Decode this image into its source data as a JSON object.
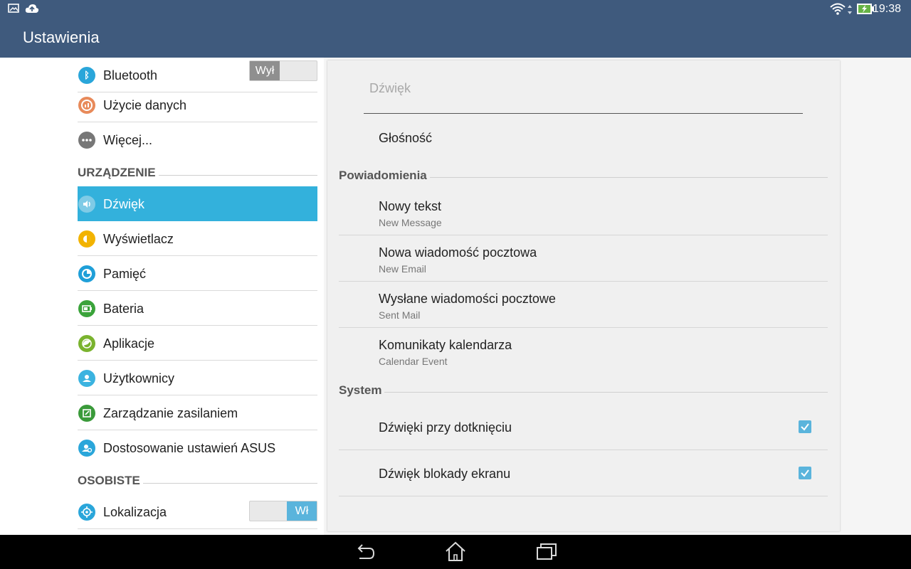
{
  "status_bar": {
    "time": "19:38"
  },
  "app": {
    "title": "Ustawienia"
  },
  "sidebar": {
    "items": [
      {
        "label": "Bluetooth",
        "icon": "bluetooth-icon",
        "color": "#2aa6da",
        "toggle": "Wył",
        "toggle_on": false
      },
      {
        "label": "Użycie danych",
        "icon": "data-usage-icon",
        "color": "#e88a5a"
      },
      {
        "label": "Więcej...",
        "icon": "more-icon",
        "color": "#777777"
      },
      {
        "label": "Dźwięk",
        "icon": "sound-icon",
        "color": "#33b1dc",
        "selected": true
      },
      {
        "label": "Wyświetlacz",
        "icon": "display-icon",
        "color": "#f2b300"
      },
      {
        "label": "Pamięć",
        "icon": "storage-icon",
        "color": "#1f9fd8"
      },
      {
        "label": "Bateria",
        "icon": "battery-icon",
        "color": "#3aa33a"
      },
      {
        "label": "Aplikacje",
        "icon": "apps-icon",
        "color": "#7ab32e"
      },
      {
        "label": "Użytkownicy",
        "icon": "users-icon",
        "color": "#3bb3e0"
      },
      {
        "label": "Zarządzanie zasilaniem",
        "icon": "power-management-icon",
        "color": "#3a9a3a"
      },
      {
        "label": "Dostosowanie ustawień ASUS",
        "icon": "asus-settings-icon",
        "color": "#2aa6da"
      },
      {
        "label": "Lokalizacja",
        "icon": "location-icon",
        "color": "#2aa6da",
        "toggle": "Wł",
        "toggle_on": true
      }
    ],
    "sections": {
      "device": "URZĄDZENIE",
      "personal": "OSOBISTE"
    }
  },
  "panel": {
    "title": "Dźwięk",
    "volume": "Głośność",
    "notifications_header": "Powiadomienia",
    "notifications": [
      {
        "title": "Nowy tekst",
        "subtitle": "New Message"
      },
      {
        "title": "Nowa wiadomość pocztowa",
        "subtitle": "New Email"
      },
      {
        "title": "Wysłane wiadomości pocztowe",
        "subtitle": "Sent Mail"
      },
      {
        "title": "Komunikaty kalendarza",
        "subtitle": "Calendar Event"
      }
    ],
    "system_header": "System",
    "system": [
      {
        "title": "Dźwięki przy dotknięciu",
        "checked": true
      },
      {
        "title": "Dźwięk blokady ekranu",
        "checked": true
      }
    ]
  },
  "colors": {
    "bar": "#3f5a7d",
    "accent": "#33b1dc",
    "toggle_on": "#5ab4dc",
    "toggle_off": "#8f8f8f"
  }
}
